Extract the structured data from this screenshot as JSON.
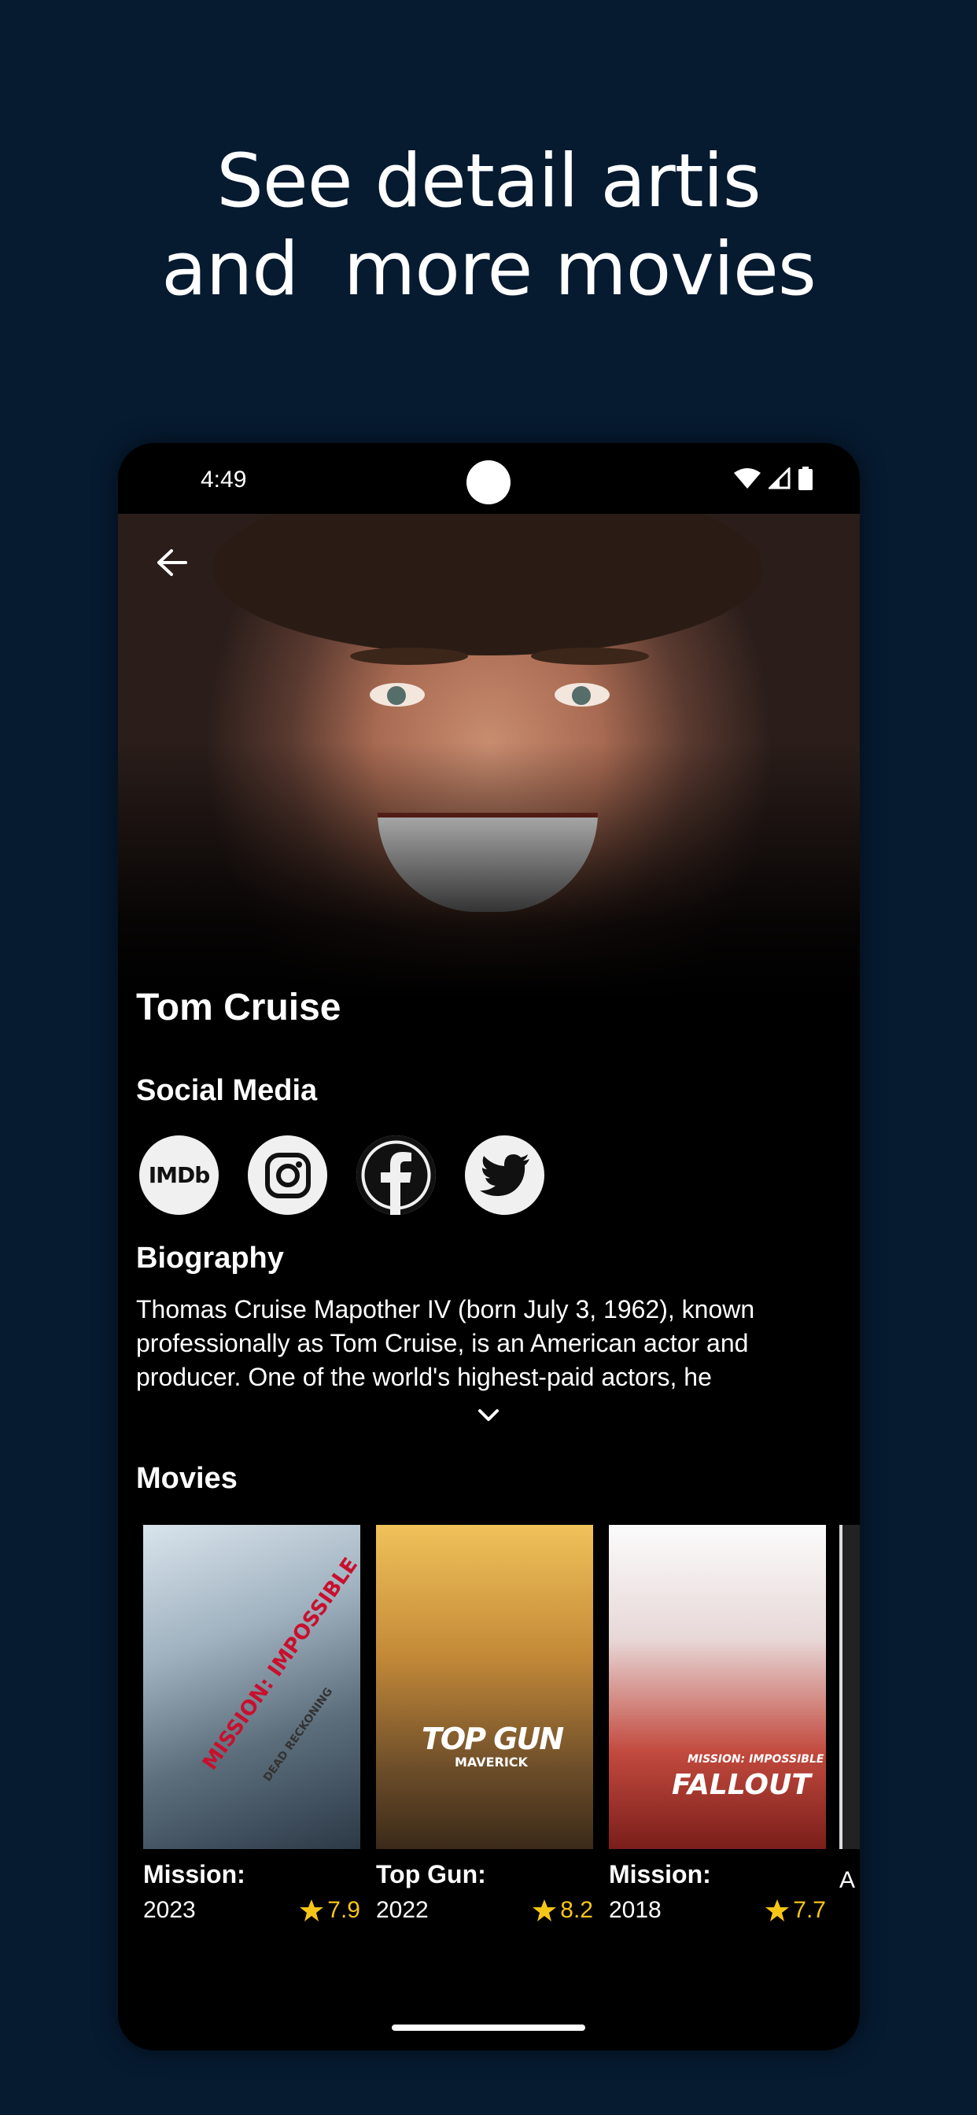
{
  "headline": {
    "line1": "See detail artis",
    "line2": "and  more movies"
  },
  "status_bar": {
    "time": "4:49",
    "icons": [
      "wifi-icon",
      "signal-icon",
      "battery-icon"
    ]
  },
  "artist": {
    "name": "Tom Cruise",
    "social_media_title": "Social Media",
    "social_links": [
      {
        "label": "IMDb",
        "icon": "imdb-icon"
      },
      {
        "icon": "instagram-icon"
      },
      {
        "icon": "facebook-icon"
      },
      {
        "icon": "twitter-icon"
      }
    ],
    "biography_title": "Biography",
    "biography": "Thomas Cruise Mapother IV (born July 3, 1962), known professionally as Tom Cruise, is an American actor and producer. One of the world's highest-paid actors, he"
  },
  "movies_section": {
    "title": "Movies",
    "items": [
      {
        "title": "Mission:",
        "year": "2023",
        "rating": "7.9",
        "poster_text": "MISSION: IMPOSSIBLE",
        "poster_subtext": "DEAD RECKONING"
      },
      {
        "title": "Top Gun:",
        "year": "2022",
        "rating": "8.2",
        "poster_text": "TOP GUN",
        "poster_subtext": "MAVERICK"
      },
      {
        "title": "Mission:",
        "year": "2018",
        "rating": "7.7",
        "poster_text": "MISSION: IMPOSSIBLE",
        "poster_subtext": "FALLOUT"
      }
    ],
    "peek_text": "A"
  },
  "colors": {
    "background": "#061a30",
    "rating_star": "#f5c518"
  }
}
